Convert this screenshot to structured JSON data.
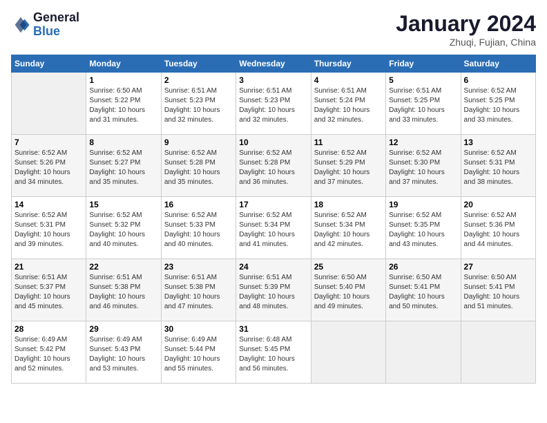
{
  "header": {
    "logo_line1": "General",
    "logo_line2": "Blue",
    "title": "January 2024",
    "subtitle": "Zhuqi, Fujian, China"
  },
  "days_of_week": [
    "Sunday",
    "Monday",
    "Tuesday",
    "Wednesday",
    "Thursday",
    "Friday",
    "Saturday"
  ],
  "weeks": [
    [
      {
        "day": "",
        "empty": true
      },
      {
        "day": "1",
        "sunrise": "6:50 AM",
        "sunset": "5:22 PM",
        "daylight": "10 hours and 31 minutes."
      },
      {
        "day": "2",
        "sunrise": "6:51 AM",
        "sunset": "5:23 PM",
        "daylight": "10 hours and 32 minutes."
      },
      {
        "day": "3",
        "sunrise": "6:51 AM",
        "sunset": "5:23 PM",
        "daylight": "10 hours and 32 minutes."
      },
      {
        "day": "4",
        "sunrise": "6:51 AM",
        "sunset": "5:24 PM",
        "daylight": "10 hours and 32 minutes."
      },
      {
        "day": "5",
        "sunrise": "6:51 AM",
        "sunset": "5:25 PM",
        "daylight": "10 hours and 33 minutes."
      },
      {
        "day": "6",
        "sunrise": "6:52 AM",
        "sunset": "5:25 PM",
        "daylight": "10 hours and 33 minutes."
      }
    ],
    [
      {
        "day": "7",
        "sunrise": "6:52 AM",
        "sunset": "5:26 PM",
        "daylight": "10 hours and 34 minutes."
      },
      {
        "day": "8",
        "sunrise": "6:52 AM",
        "sunset": "5:27 PM",
        "daylight": "10 hours and 35 minutes."
      },
      {
        "day": "9",
        "sunrise": "6:52 AM",
        "sunset": "5:28 PM",
        "daylight": "10 hours and 35 minutes."
      },
      {
        "day": "10",
        "sunrise": "6:52 AM",
        "sunset": "5:28 PM",
        "daylight": "10 hours and 36 minutes."
      },
      {
        "day": "11",
        "sunrise": "6:52 AM",
        "sunset": "5:29 PM",
        "daylight": "10 hours and 37 minutes."
      },
      {
        "day": "12",
        "sunrise": "6:52 AM",
        "sunset": "5:30 PM",
        "daylight": "10 hours and 37 minutes."
      },
      {
        "day": "13",
        "sunrise": "6:52 AM",
        "sunset": "5:31 PM",
        "daylight": "10 hours and 38 minutes."
      }
    ],
    [
      {
        "day": "14",
        "sunrise": "6:52 AM",
        "sunset": "5:31 PM",
        "daylight": "10 hours and 39 minutes."
      },
      {
        "day": "15",
        "sunrise": "6:52 AM",
        "sunset": "5:32 PM",
        "daylight": "10 hours and 40 minutes."
      },
      {
        "day": "16",
        "sunrise": "6:52 AM",
        "sunset": "5:33 PM",
        "daylight": "10 hours and 40 minutes."
      },
      {
        "day": "17",
        "sunrise": "6:52 AM",
        "sunset": "5:34 PM",
        "daylight": "10 hours and 41 minutes."
      },
      {
        "day": "18",
        "sunrise": "6:52 AM",
        "sunset": "5:34 PM",
        "daylight": "10 hours and 42 minutes."
      },
      {
        "day": "19",
        "sunrise": "6:52 AM",
        "sunset": "5:35 PM",
        "daylight": "10 hours and 43 minutes."
      },
      {
        "day": "20",
        "sunrise": "6:52 AM",
        "sunset": "5:36 PM",
        "daylight": "10 hours and 44 minutes."
      }
    ],
    [
      {
        "day": "21",
        "sunrise": "6:51 AM",
        "sunset": "5:37 PM",
        "daylight": "10 hours and 45 minutes."
      },
      {
        "day": "22",
        "sunrise": "6:51 AM",
        "sunset": "5:38 PM",
        "daylight": "10 hours and 46 minutes."
      },
      {
        "day": "23",
        "sunrise": "6:51 AM",
        "sunset": "5:38 PM",
        "daylight": "10 hours and 47 minutes."
      },
      {
        "day": "24",
        "sunrise": "6:51 AM",
        "sunset": "5:39 PM",
        "daylight": "10 hours and 48 minutes."
      },
      {
        "day": "25",
        "sunrise": "6:50 AM",
        "sunset": "5:40 PM",
        "daylight": "10 hours and 49 minutes."
      },
      {
        "day": "26",
        "sunrise": "6:50 AM",
        "sunset": "5:41 PM",
        "daylight": "10 hours and 50 minutes."
      },
      {
        "day": "27",
        "sunrise": "6:50 AM",
        "sunset": "5:41 PM",
        "daylight": "10 hours and 51 minutes."
      }
    ],
    [
      {
        "day": "28",
        "sunrise": "6:49 AM",
        "sunset": "5:42 PM",
        "daylight": "10 hours and 52 minutes."
      },
      {
        "day": "29",
        "sunrise": "6:49 AM",
        "sunset": "5:43 PM",
        "daylight": "10 hours and 53 minutes."
      },
      {
        "day": "30",
        "sunrise": "6:49 AM",
        "sunset": "5:44 PM",
        "daylight": "10 hours and 55 minutes."
      },
      {
        "day": "31",
        "sunrise": "6:48 AM",
        "sunset": "5:45 PM",
        "daylight": "10 hours and 56 minutes."
      },
      {
        "day": "",
        "empty": true
      },
      {
        "day": "",
        "empty": true
      },
      {
        "day": "",
        "empty": true
      }
    ]
  ]
}
